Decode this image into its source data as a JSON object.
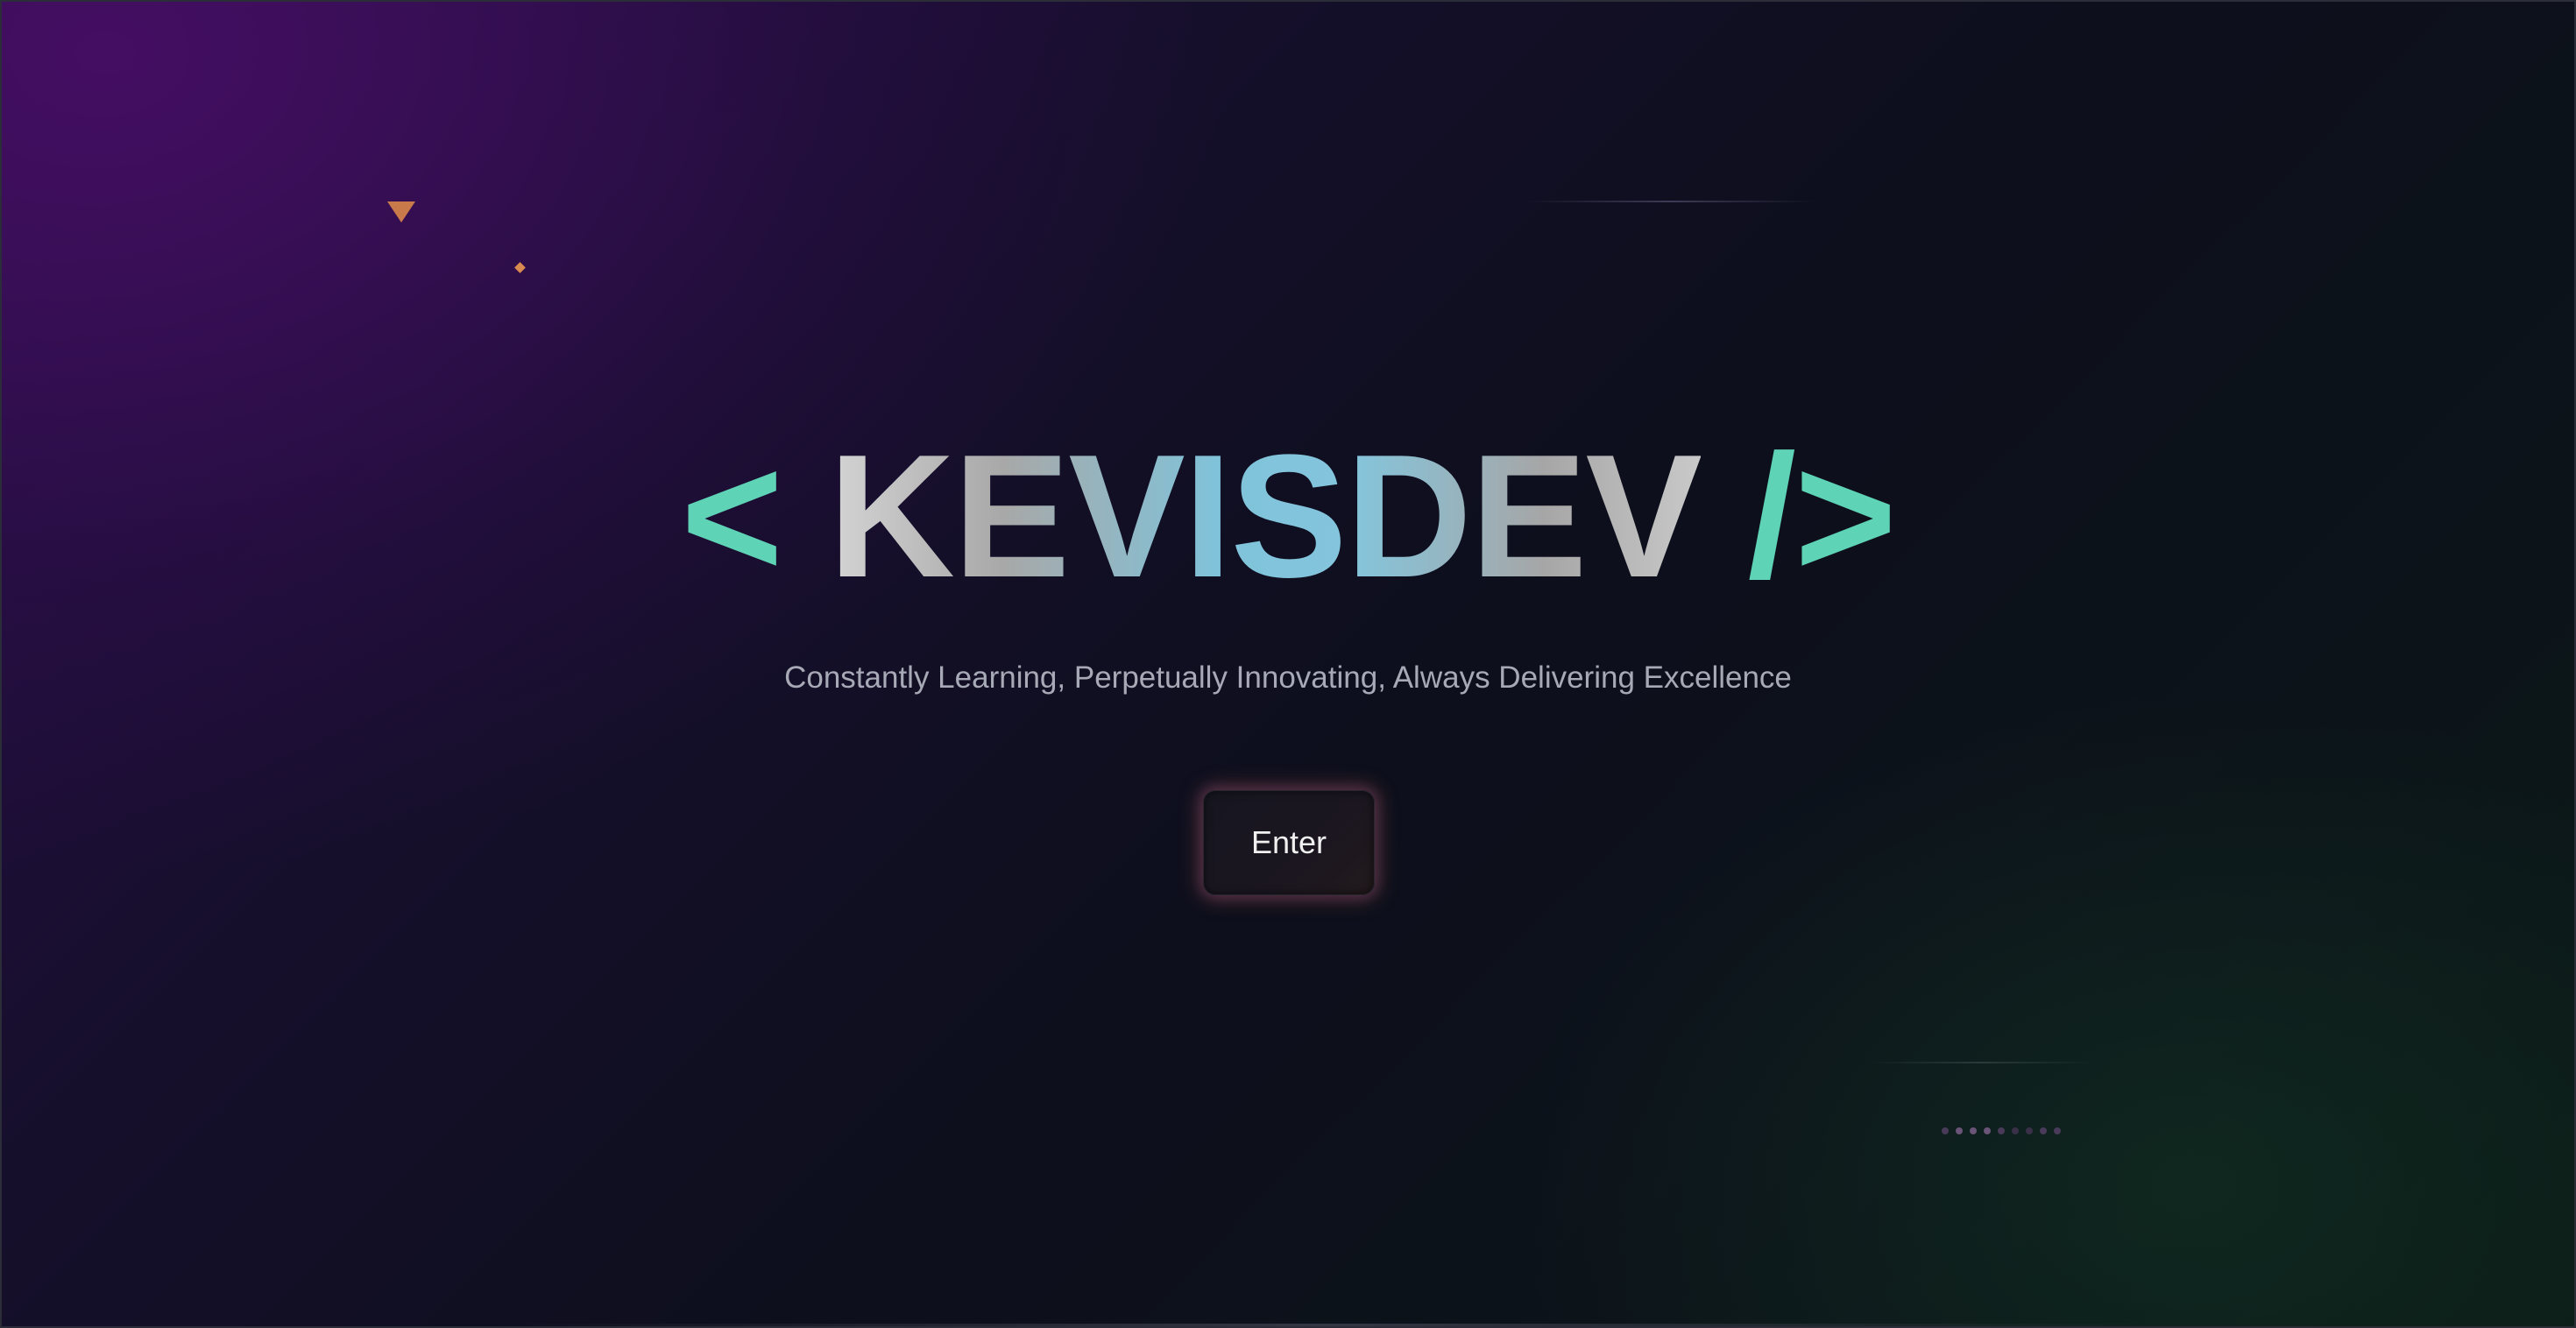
{
  "logo": {
    "open_bracket": "< ",
    "brand": "KEVISDEV",
    "close_bracket": " />"
  },
  "tagline": "Constantly Learning, Perpetually Innovating, Always Delivering Excellence",
  "enter_button": {
    "label": "Enter"
  },
  "colors": {
    "bracket_accent": "#5fd3b6",
    "brand_gradient_mid": "#7fc3da",
    "triangle_accent": "#c87a4a",
    "diamond_accent": "#d98a50",
    "tagline_text": "#a7a9b6",
    "button_glow": "#96503c"
  },
  "decorations": {
    "triangle_icon": "triangle-down-icon",
    "diamond_icon": "diamond-icon",
    "dot_count": "9"
  }
}
